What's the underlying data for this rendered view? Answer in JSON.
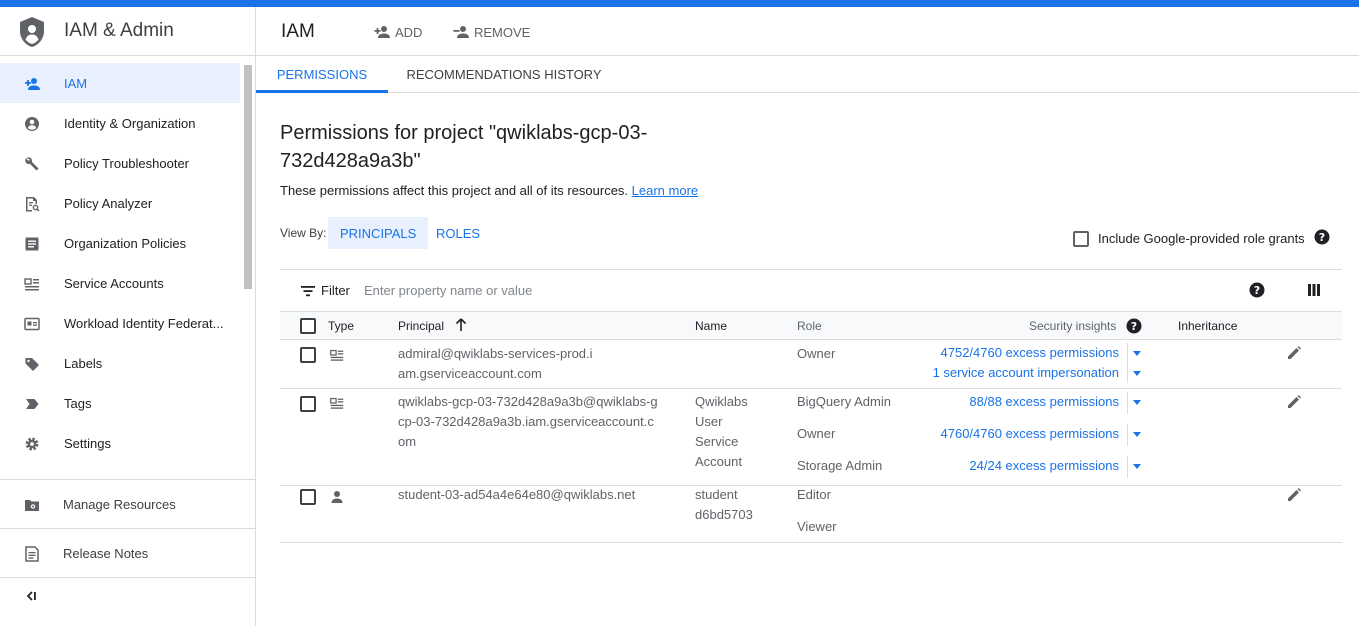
{
  "sidebar": {
    "title": "IAM & Admin",
    "items": [
      {
        "label": "IAM",
        "icon": "person-add-icon",
        "active": true
      },
      {
        "label": "Identity & Organization",
        "icon": "account-circle-icon"
      },
      {
        "label": "Policy Troubleshooter",
        "icon": "wrench-icon"
      },
      {
        "label": "Policy Analyzer",
        "icon": "policy-analyzer-icon"
      },
      {
        "label": "Organization Policies",
        "icon": "document-list-icon"
      },
      {
        "label": "Service Accounts",
        "icon": "service-account-icon"
      },
      {
        "label": "Workload Identity Federat...",
        "icon": "id-card-icon"
      },
      {
        "label": "Labels",
        "icon": "label-icon"
      },
      {
        "label": "Tags",
        "icon": "tag-icon"
      },
      {
        "label": "Settings",
        "icon": "gear-icon"
      }
    ],
    "manage_resources": "Manage Resources",
    "release_notes": "Release Notes"
  },
  "header": {
    "title": "IAM",
    "add_label": "ADD",
    "remove_label": "REMOVE"
  },
  "tabs": [
    "PERMISSIONS",
    "RECOMMENDATIONS HISTORY"
  ],
  "main": {
    "title": "Permissions for project \"qwiklabs-gcp-03-732d428a9a3b\"",
    "description": "These permissions affect this project and all of its resources.",
    "learn_more": "Learn more",
    "view_by_label": "View By:",
    "view_by_principals": "PRINCIPALS",
    "view_by_roles": "ROLES",
    "google_grants_label": "Include Google-provided role grants"
  },
  "filter": {
    "label": "Filter",
    "placeholder": "Enter property name or value"
  },
  "table": {
    "headers": {
      "type": "Type",
      "principal": "Principal",
      "name": "Name",
      "role": "Role",
      "security": "Security insights",
      "inheritance": "Inheritance"
    },
    "rows": [
      {
        "type_icon": "service-account-icon",
        "principal": "admiral@qwiklabs-services-prod.iam.gserviceaccount.com",
        "name": "",
        "roles": [
          "Owner"
        ],
        "insights": [
          {
            "num": "4752",
            "rest": "/4760 excess permissions"
          },
          {
            "num": "",
            "rest": "1 service account impersonation"
          }
        ]
      },
      {
        "type_icon": "service-account-icon",
        "principal": "qwiklabs-gcp-03-732d428a9a3b@qwiklabs-gcp-03-732d428a9a3b.iam.gserviceaccount.com",
        "name": "Qwiklabs User Service Account",
        "roles": [
          "BigQuery Admin",
          "Owner",
          "Storage Admin"
        ],
        "insights": [
          {
            "num": "88",
            "rest": "/88 excess permissions"
          },
          {
            "num": "4760",
            "rest": "/4760 excess permissions"
          },
          {
            "num": "24",
            "rest": "/24 excess permissions"
          }
        ]
      },
      {
        "type_icon": "person-icon",
        "principal": "student-03-ad54a4e64e80@qwiklabs.net",
        "name": "student d6bd5703",
        "roles": [
          "Editor",
          "Viewer"
        ],
        "insights": []
      }
    ]
  },
  "colors": {
    "accent": "#1a73e8",
    "active_bg": "#e8f0fe",
    "border": "#dadce0"
  }
}
